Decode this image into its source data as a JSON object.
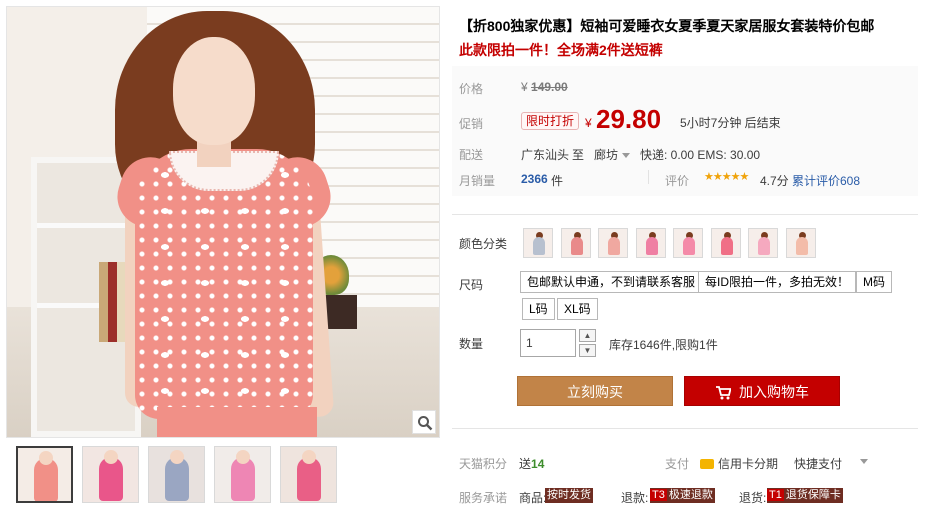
{
  "product": {
    "title": "【折800独家优惠】短袖可爱睡衣女夏季夏天家居服女套装特价包邮",
    "promo": "此款限拍一件！全场满2件送短裤"
  },
  "price": {
    "label": "价格",
    "original_symbol": "¥",
    "original": "149.00"
  },
  "promotion": {
    "label": "促销",
    "badge": "限时打折",
    "symbol": "¥",
    "price": "29.80",
    "countdown": "5小时7分钟 后结束"
  },
  "shipping": {
    "label": "配送",
    "from": "广东汕头",
    "to_label": "至",
    "destination": "廊坊",
    "fees": "快递: 0.00 EMS: 30.00"
  },
  "sales": {
    "label": "月销量",
    "count": "2366",
    "unit": "件",
    "rating_label": "评价",
    "stars": "★★★★★",
    "score": "4.7分",
    "reviews": "累计评价608"
  },
  "colors": {
    "label": "颜色分类",
    "swatches": [
      {
        "color": "#b7c0cf"
      },
      {
        "color": "#e98a8a"
      },
      {
        "color": "#f0a8a0"
      },
      {
        "color": "#ef7fa3"
      },
      {
        "color": "#f48aa8"
      },
      {
        "color": "#f06f86"
      },
      {
        "color": "#f5a9bf"
      },
      {
        "color": "#f3bca9"
      }
    ]
  },
  "sizes": {
    "label": "尺码",
    "options": [
      "包邮默认申通，不到请联系客服",
      "每ID限拍一件，多拍无效！",
      "M码",
      "L码",
      "XL码"
    ]
  },
  "quantity": {
    "label": "数量",
    "value": "1",
    "stock": "库存1646件,限购1件"
  },
  "actions": {
    "buy_now": "立刻购买",
    "add_to_cart": "加入购物车"
  },
  "points": {
    "label": "天猫积分",
    "prefix": "送",
    "value": "14"
  },
  "payment": {
    "label": "支付",
    "credit": "信用卡分期",
    "quick": "快捷支付"
  },
  "service": {
    "label": "服务承诺",
    "items": [
      {
        "prefix": "商品:",
        "tag": "按时发货",
        "key": ""
      },
      {
        "prefix": "退款:",
        "tag": "极速退款",
        "key": "T3"
      },
      {
        "prefix": "退货:",
        "tag": "退货保障卡",
        "key": "T1"
      }
    ]
  },
  "thumbnails": [
    {
      "bg": "#f4ece6",
      "fig": "#f19087"
    },
    {
      "bg": "#f2e6e2",
      "fig": "#e9568a"
    },
    {
      "bg": "#e8e1de",
      "fig": "#9aa6c2"
    },
    {
      "bg": "#f1ece9",
      "fig": "#ee86b4"
    },
    {
      "bg": "#efe4de",
      "fig": "#e95f86"
    }
  ]
}
